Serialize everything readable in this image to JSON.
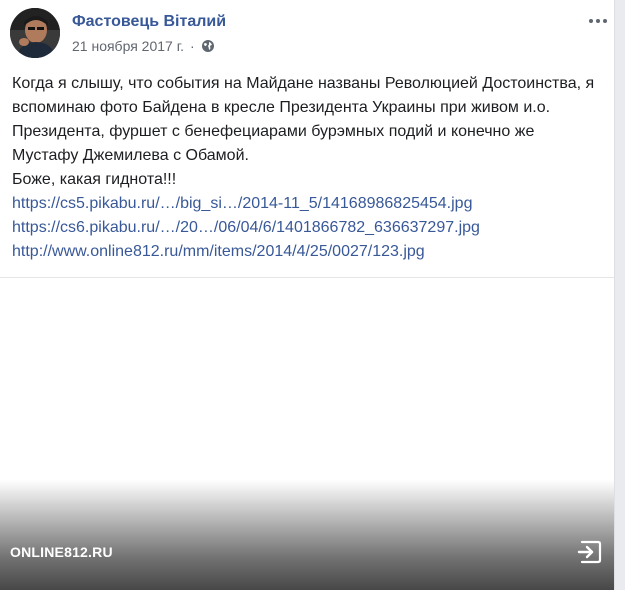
{
  "post": {
    "author_name": "Фастовець Віталий",
    "date": "21 ноября 2017 г.",
    "separator": "·",
    "privacy_icon": "globe-icon",
    "more_icon": "more-options-icon",
    "body_lines": [
      "Когда я слышу, что события на Майдане названы Революцией Достоинства, я вспоминаю фото Байдена в кресле Президента Украины при живом и.о. Президента, фуршет с бенефециарами бурэмных подий и конечно же Мустафу Джемилева с Обамой.",
      "Боже, какая гиднота!!!"
    ],
    "links": [
      "https://cs5.pikabu.ru/…/big_si…/2014-11_5/14168986825454.jpg",
      "https://cs6.pikabu.ru/…/20…/06/04/6/1401866782_636637297.jpg",
      "http://www.online812.ru/mm/items/2014/4/25/0027/123.jpg"
    ]
  },
  "attachment": {
    "source_label": "ONLINE812.RU",
    "share_icon": "share-exit-icon"
  },
  "colors": {
    "link": "#385898",
    "text": "#1c1e21",
    "meta": "#616770"
  }
}
